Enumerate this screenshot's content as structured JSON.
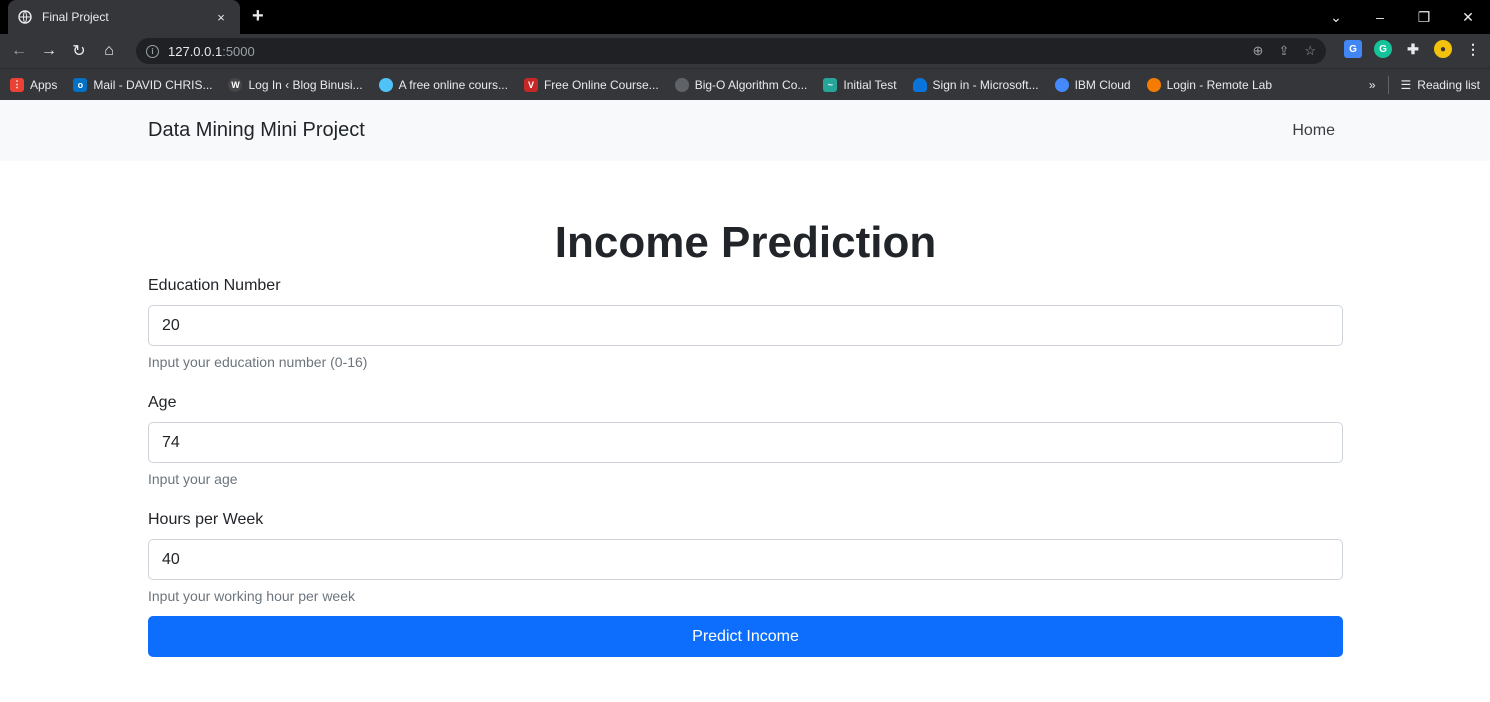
{
  "browser": {
    "tab_title": "Final Project",
    "tab_close": "×",
    "new_tab": "+",
    "window_controls": [
      "⌄",
      "–",
      "❐",
      "✕"
    ],
    "url_host": "127.0.0.1",
    "url_port": ":5000",
    "nav": {
      "back": "←",
      "forward": "→",
      "reload": "↻",
      "home": "⌂"
    },
    "bookmarks": [
      {
        "label": "Apps",
        "icon": "apps-grid-icon",
        "color": "#ea4335"
      },
      {
        "label": "Mail - DAVID CHRIS...",
        "icon": "outlook-icon",
        "color": "#0072c6"
      },
      {
        "label": "Log In ‹ Blog Binusi...",
        "icon": "wordpress-icon",
        "color": "#464646"
      },
      {
        "label": "A free online cours...",
        "icon": "course-icon",
        "color": "#4fc3f7"
      },
      {
        "label": "Free Online Course...",
        "icon": "harvard-icon",
        "color": "#c62828"
      },
      {
        "label": "Big-O Algorithm Co...",
        "icon": "globe-icon",
        "color": "#5f6368"
      },
      {
        "label": "Initial Test",
        "icon": "test-icon",
        "color": "#26a69a"
      },
      {
        "label": "Sign in - Microsoft...",
        "icon": "onedrive-icon",
        "color": "#0a74da"
      },
      {
        "label": "IBM Cloud",
        "icon": "ibm-cloud-icon",
        "color": "#4589ff"
      },
      {
        "label": "Login - Remote Lab",
        "icon": "remote-lab-icon",
        "color": "#f57c00"
      }
    ],
    "bookmarks_overflow": "»",
    "reading_list": "Reading list"
  },
  "navbar": {
    "brand": "Data Mining Mini Project",
    "link_home": "Home"
  },
  "form": {
    "title": "Income Prediction",
    "education": {
      "label": "Education Number",
      "value": "20",
      "hint": "Input your education number (0-16)"
    },
    "age": {
      "label": "Age",
      "value": "74",
      "hint": "Input your age"
    },
    "hours": {
      "label": "Hours per Week",
      "value": "40",
      "hint": "Input your working hour per week"
    },
    "submit_label": "Predict Income"
  },
  "colors": {
    "primary": "#0d6efd",
    "navbar_bg": "#f8f9fa",
    "chrome_bg": "#35363a"
  }
}
